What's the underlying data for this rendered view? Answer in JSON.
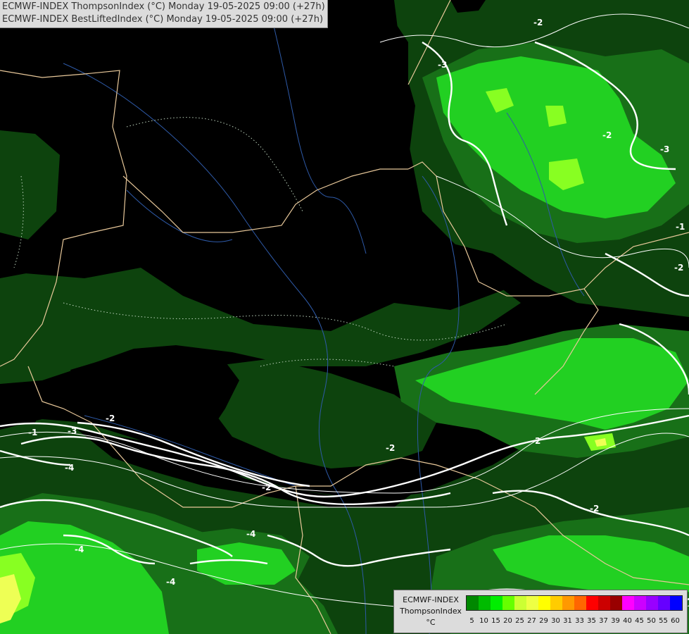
{
  "header": {
    "line1": "ECMWF-INDEX ThompsonIndex (°C) Monday 19-05-2025 09:00 (+27h)",
    "line2": "ECMWF-INDEX BestLiftedIndex (°C) Monday 19-05-2025 09:00 (+27h)"
  },
  "legend": {
    "title_model": "ECMWF-INDEX",
    "title_param": "ThompsonIndex",
    "unit": "°C",
    "colors": [
      "#000000",
      "#000000",
      "#000000",
      "#000000",
      "#003300",
      "#006600",
      "#008800",
      "#00bb00",
      "#00ee00",
      "#66ff00",
      "#ccff33",
      "#eeff44",
      "#ffff00",
      "#ffcc00",
      "#ff9900",
      "#ff6600",
      "#ff0000",
      "#cc0000",
      "#990000",
      "#ff00ff",
      "#cc00ff",
      "#9900ff",
      "#6600ff",
      "#0000ff"
    ],
    "ticks": [
      "5",
      "10",
      "15",
      "20",
      "25",
      "27",
      "29",
      "30",
      "31",
      "33",
      "35",
      "37",
      "39",
      "40",
      "45",
      "50",
      "55",
      "60"
    ]
  },
  "contour_labels": [
    "-2",
    "-3",
    "-2",
    "-3",
    "-2",
    "-1",
    "-2",
    "-1",
    "-2",
    "-3",
    "-2",
    "-4",
    "-2",
    "-4",
    "-4",
    "-4",
    "-2"
  ],
  "palette": {
    "dark_green": "#0d430d",
    "mid_green": "#186c18",
    "green": "#20a020",
    "bright_green": "#22dd22",
    "lime": "#88ff22",
    "yellow": "#eeff55",
    "contour": "#ffffff"
  }
}
